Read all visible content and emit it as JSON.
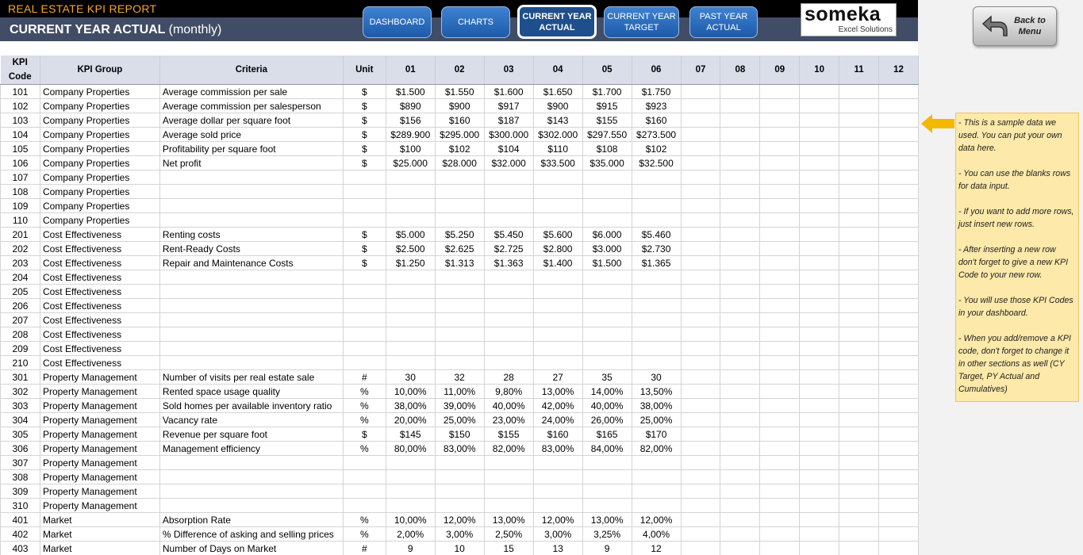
{
  "header": {
    "report_title": "REAL ESTATE KPI REPORT",
    "page_title": "CURRENT YEAR ACTUAL",
    "page_subtitle": "(monthly)"
  },
  "nav": {
    "dashboard": "DASHBOARD",
    "charts": "CHARTS",
    "cy_actual_1": "CURRENT YEAR",
    "cy_actual_2": "ACTUAL",
    "cy_target_1": "CURRENT YEAR",
    "cy_target_2": "TARGET",
    "py_actual_1": "PAST YEAR",
    "py_actual_2": "ACTUAL"
  },
  "logo": {
    "brand": "someka",
    "tagline": "Excel Solutions"
  },
  "back_button": {
    "line1": "Back to",
    "line2": "Menu"
  },
  "note": {
    "p1": "- This is a sample data we used. You can put your own data here.",
    "p2": "- You can use the blanks rows for data input.",
    "p3": "- If you want to add more rows, just insert new rows.",
    "p4": "- After inserting a new row don't forget to give a new KPI Code to your new row.",
    "p5": "- You will use those KPI Codes in your dashboard.",
    "p6": "- When you add/remove a KPI code, don't forget to change it in other sections as well (CY Target, PY Actual and Cumulatives)"
  },
  "table": {
    "headers": {
      "code_1": "KPI",
      "code_2": "Code",
      "group": "KPI Group",
      "criteria": "Criteria",
      "unit": "Unit",
      "months": [
        "01",
        "02",
        "03",
        "04",
        "05",
        "06",
        "07",
        "08",
        "09",
        "10",
        "11",
        "12"
      ]
    },
    "rows": [
      [
        "101",
        "Company Properties",
        "Average commission per sale",
        "$",
        "$1.500",
        "$1.550",
        "$1.600",
        "$1.650",
        "$1.700",
        "$1.750"
      ],
      [
        "102",
        "Company Properties",
        "Average commission per salesperson",
        "$",
        "$890",
        "$900",
        "$917",
        "$900",
        "$915",
        "$923"
      ],
      [
        "103",
        "Company Properties",
        "Average dollar per square foot",
        "$",
        "$156",
        "$160",
        "$187",
        "$143",
        "$155",
        "$160"
      ],
      [
        "104",
        "Company Properties",
        "Average sold price",
        "$",
        "$289.900",
        "$295.000",
        "$300.000",
        "$302.000",
        "$297.550",
        "$273.500"
      ],
      [
        "105",
        "Company Properties",
        "Profitability per square foot",
        "$",
        "$100",
        "$102",
        "$104",
        "$110",
        "$108",
        "$102"
      ],
      [
        "106",
        "Company Properties",
        "Net profit",
        "$",
        "$25.000",
        "$28.000",
        "$32.000",
        "$33.500",
        "$35.000",
        "$32.500"
      ],
      [
        "107",
        "Company Properties",
        "",
        "",
        "",
        "",
        "",
        "",
        "",
        ""
      ],
      [
        "108",
        "Company Properties",
        "",
        "",
        "",
        "",
        "",
        "",
        "",
        ""
      ],
      [
        "109",
        "Company Properties",
        "",
        "",
        "",
        "",
        "",
        "",
        "",
        ""
      ],
      [
        "110",
        "Company Properties",
        "",
        "",
        "",
        "",
        "",
        "",
        "",
        ""
      ],
      [
        "201",
        "Cost Effectiveness",
        "Renting costs",
        "$",
        "$5.000",
        "$5.250",
        "$5.450",
        "$5.600",
        "$6.000",
        "$5.460"
      ],
      [
        "202",
        "Cost Effectiveness",
        "Rent-Ready Costs",
        "$",
        "$2.500",
        "$2.625",
        "$2.725",
        "$2.800",
        "$3.000",
        "$2.730"
      ],
      [
        "203",
        "Cost Effectiveness",
        "Repair and Maintenance Costs",
        "$",
        "$1.250",
        "$1.313",
        "$1.363",
        "$1.400",
        "$1.500",
        "$1.365"
      ],
      [
        "204",
        "Cost Effectiveness",
        "",
        "",
        "",
        "",
        "",
        "",
        "",
        ""
      ],
      [
        "205",
        "Cost Effectiveness",
        "",
        "",
        "",
        "",
        "",
        "",
        "",
        ""
      ],
      [
        "206",
        "Cost Effectiveness",
        "",
        "",
        "",
        "",
        "",
        "",
        "",
        ""
      ],
      [
        "207",
        "Cost Effectiveness",
        "",
        "",
        "",
        "",
        "",
        "",
        "",
        ""
      ],
      [
        "208",
        "Cost Effectiveness",
        "",
        "",
        "",
        "",
        "",
        "",
        "",
        ""
      ],
      [
        "209",
        "Cost Effectiveness",
        "",
        "",
        "",
        "",
        "",
        "",
        "",
        ""
      ],
      [
        "210",
        "Cost Effectiveness",
        "",
        "",
        "",
        "",
        "",
        "",
        "",
        ""
      ],
      [
        "301",
        "Property Management",
        "Number of visits per real estate sale",
        "#",
        "30",
        "32",
        "28",
        "27",
        "35",
        "30"
      ],
      [
        "302",
        "Property Management",
        "Rented space usage quality",
        "%",
        "10,00%",
        "11,00%",
        "9,80%",
        "13,00%",
        "14,00%",
        "13,50%"
      ],
      [
        "303",
        "Property Management",
        "Sold homes per available inventory ratio",
        "%",
        "38,00%",
        "39,00%",
        "40,00%",
        "42,00%",
        "40,00%",
        "38,00%"
      ],
      [
        "304",
        "Property Management",
        "Vacancy rate",
        "%",
        "20,00%",
        "25,00%",
        "23,00%",
        "24,00%",
        "26,00%",
        "25,00%"
      ],
      [
        "305",
        "Property Management",
        "Revenue per square foot",
        "$",
        "$145",
        "$150",
        "$155",
        "$160",
        "$165",
        "$170"
      ],
      [
        "306",
        "Property Management",
        "Management efficiency",
        "%",
        "80,00%",
        "83,00%",
        "82,00%",
        "83,00%",
        "84,00%",
        "82,00%"
      ],
      [
        "307",
        "Property Management",
        "",
        "",
        "",
        "",
        "",
        "",
        "",
        ""
      ],
      [
        "308",
        "Property Management",
        "",
        "",
        "",
        "",
        "",
        "",
        "",
        ""
      ],
      [
        "309",
        "Property Management",
        "",
        "",
        "",
        "",
        "",
        "",
        "",
        ""
      ],
      [
        "310",
        "Property Management",
        "",
        "",
        "",
        "",
        "",
        "",
        "",
        ""
      ],
      [
        "401",
        "Market",
        "Absorption Rate",
        "%",
        "10,00%",
        "12,00%",
        "13,00%",
        "12,00%",
        "13,00%",
        "12,00%"
      ],
      [
        "402",
        "Market",
        "% Difference of asking and selling prices",
        "%",
        "2,00%",
        "3,00%",
        "2,50%",
        "3,00%",
        "3,25%",
        "4,00%"
      ],
      [
        "403",
        "Market",
        "Number of Days on Market",
        "#",
        "9",
        "10",
        "15",
        "13",
        "9",
        "12"
      ]
    ]
  },
  "colors": {
    "header_bar": "#414d66",
    "report_title": "#f0a830",
    "nav_button": "#2d6cc0",
    "note_bg": "#fde9a9",
    "note_arrow": "#f5b800",
    "table_header": "#d9dee9"
  }
}
